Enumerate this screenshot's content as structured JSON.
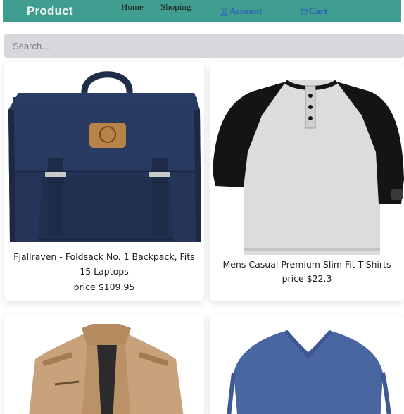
{
  "navbar": {
    "brand": "Product",
    "links": {
      "home": "Home",
      "shopping": "Shoping",
      "account": "Account",
      "cart": "Cart"
    },
    "colors": {
      "background": "#3f9e8f",
      "accent": "#2f63b8"
    }
  },
  "search": {
    "placeholder": "Search..."
  },
  "products": [
    {
      "title": "Fjallraven - Foldsack No. 1 Backpack, Fits 15 Laptops",
      "price": "price $109.95",
      "image": "navy-backpack"
    },
    {
      "title": "Mens Casual Premium Slim Fit T-Shirts",
      "price": "price $22.3",
      "image": "raglan-henley-shirt"
    },
    {
      "title": "",
      "price": "",
      "image": "tan-jacket"
    },
    {
      "title": "",
      "price": "",
      "image": "blue-vneck-shirt"
    }
  ]
}
